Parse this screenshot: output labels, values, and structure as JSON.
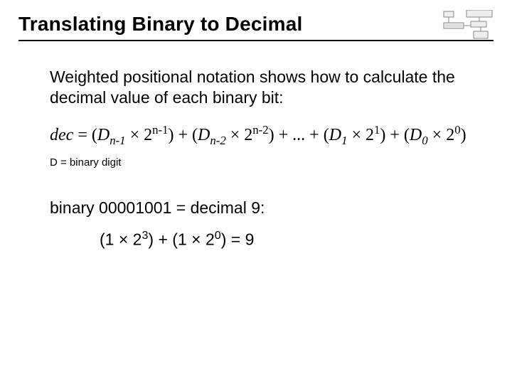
{
  "title": "Translating Binary to Decimal",
  "intro": "Weighted positional notation shows how to calculate the decimal value of each binary bit:",
  "formula_html": "dec <span class='sym'>= (</span>D<sub>n-1</sub> <span class='sym'>× 2</span><sup>n-1</sup><span class='sym'>) + (</span>D<sub>n-2</sub> <span class='sym'>× 2</span><sup>n-2</sup><span class='sym'>) + ... + (</span>D<sub>1</sub> <span class='sym'>× 2</span><sup>1</sup><span class='sym'>) + (</span>D<sub>0</sub> <span class='sym'>× 2</span><sup>0</sup><span class='sym'>)</span>",
  "note": "D = binary digit",
  "example_line1": "binary 00001001 = decimal 9:",
  "example_line2_html": "(1 × 2<sup>3</sup>) + (1 × 2<sup>0</sup>) = 9",
  "chart_data": {
    "type": "table",
    "formula": "dec = (D_{n-1} * 2^{n-1}) + (D_{n-2} * 2^{n-2}) + ... + (D_1 * 2^1) + (D_0 * 2^0)",
    "example_binary": "00001001",
    "example_decimal": 9,
    "example_expansion": "(1 * 2^3) + (1 * 2^0) = 9"
  }
}
